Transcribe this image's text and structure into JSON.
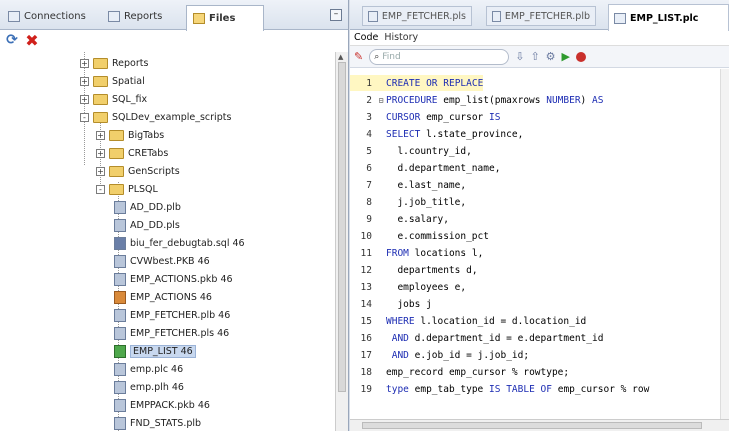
{
  "left_tabs": [
    {
      "label": "Connections"
    },
    {
      "label": "Reports"
    },
    {
      "label": "Files"
    }
  ],
  "tree": [
    {
      "label": "Reports",
      "type": "folder",
      "expander": "+"
    },
    {
      "label": "Spatial",
      "type": "folder",
      "expander": "+"
    },
    {
      "label": "SQL_fix",
      "type": "folder",
      "expander": "+"
    },
    {
      "label": "SQLDev_example_scripts",
      "type": "folder",
      "expander": "-"
    },
    {
      "label": "BigTabs",
      "type": "folder",
      "expander": "+"
    },
    {
      "label": "CRETabs",
      "type": "folder",
      "expander": "+"
    },
    {
      "label": "GenScripts",
      "type": "folder",
      "expander": "+"
    },
    {
      "label": "PLSQL",
      "type": "folder",
      "expander": "-"
    },
    {
      "label": "AD_DD.plb",
      "type": "file"
    },
    {
      "label": "AD_DD.pls",
      "type": "file"
    },
    {
      "label": "biu_fer_debugtab.sql 46",
      "type": "db"
    },
    {
      "label": "CVWbest.PKB 46",
      "type": "file"
    },
    {
      "label": "EMP_ACTIONS.pkb 46",
      "type": "file"
    },
    {
      "label": "EMP_ACTIONS 46",
      "type": "pkg"
    },
    {
      "label": "EMP_FETCHER.plb 46",
      "type": "file"
    },
    {
      "label": "EMP_FETCHER.pls 46",
      "type": "file"
    },
    {
      "label": "EMP_LIST 46",
      "type": "green",
      "selected": true
    },
    {
      "label": "emp.plc 46",
      "type": "file"
    },
    {
      "label": "emp.plh 46",
      "type": "file"
    },
    {
      "label": "EMPPACK.pkb 46",
      "type": "file"
    },
    {
      "label": "FND_STATS.plb",
      "type": "file"
    },
    {
      "label": "FND_STATS.pls",
      "type": "file"
    }
  ],
  "right_tabs": [
    {
      "label": "EMP_FETCHER.pls"
    },
    {
      "label": "EMP_FETCHER.plb"
    },
    {
      "label": "EMP_LIST.plc"
    }
  ],
  "sub_tabs": [
    {
      "label": "Code"
    },
    {
      "label": "History"
    }
  ],
  "find_placeholder": "Find",
  "code": [
    {
      "n": "1",
      "g": "",
      "t": "CREATE OR REPLACE"
    },
    {
      "n": "2",
      "g": "⊟",
      "t": "PROCEDURE emp_list(pmaxrows NUMBER) AS"
    },
    {
      "n": "3",
      "g": "",
      "t": "CURSOR emp_cursor IS"
    },
    {
      "n": "4",
      "g": "",
      "t": "SELECT l.state_province,"
    },
    {
      "n": "5",
      "g": "",
      "t": "  l.country_id,"
    },
    {
      "n": "6",
      "g": "",
      "t": "  d.department_name,"
    },
    {
      "n": "7",
      "g": "",
      "t": "  e.last_name,"
    },
    {
      "n": "8",
      "g": "",
      "t": "  j.job_title,"
    },
    {
      "n": "9",
      "g": "",
      "t": "  e.salary,"
    },
    {
      "n": "10",
      "g": "",
      "t": "  e.commission_pct"
    },
    {
      "n": "11",
      "g": "",
      "t": "FROM locations l,"
    },
    {
      "n": "12",
      "g": "",
      "t": "  departments d,"
    },
    {
      "n": "13",
      "g": "",
      "t": "  employees e,"
    },
    {
      "n": "14",
      "g": "",
      "t": "  jobs j"
    },
    {
      "n": "15",
      "g": "",
      "t": "WHERE l.location_id = d.location_id"
    },
    {
      "n": "16",
      "g": "",
      "t": " AND d.department_id = e.department_id"
    },
    {
      "n": "17",
      "g": "",
      "t": " AND e.job_id = j.job_id;"
    },
    {
      "n": "18",
      "g": "",
      "t": "emp_record emp_cursor % rowtype;"
    },
    {
      "n": "19",
      "g": "",
      "t": "type emp_tab_type IS TABLE OF emp_cursor % row"
    }
  ]
}
